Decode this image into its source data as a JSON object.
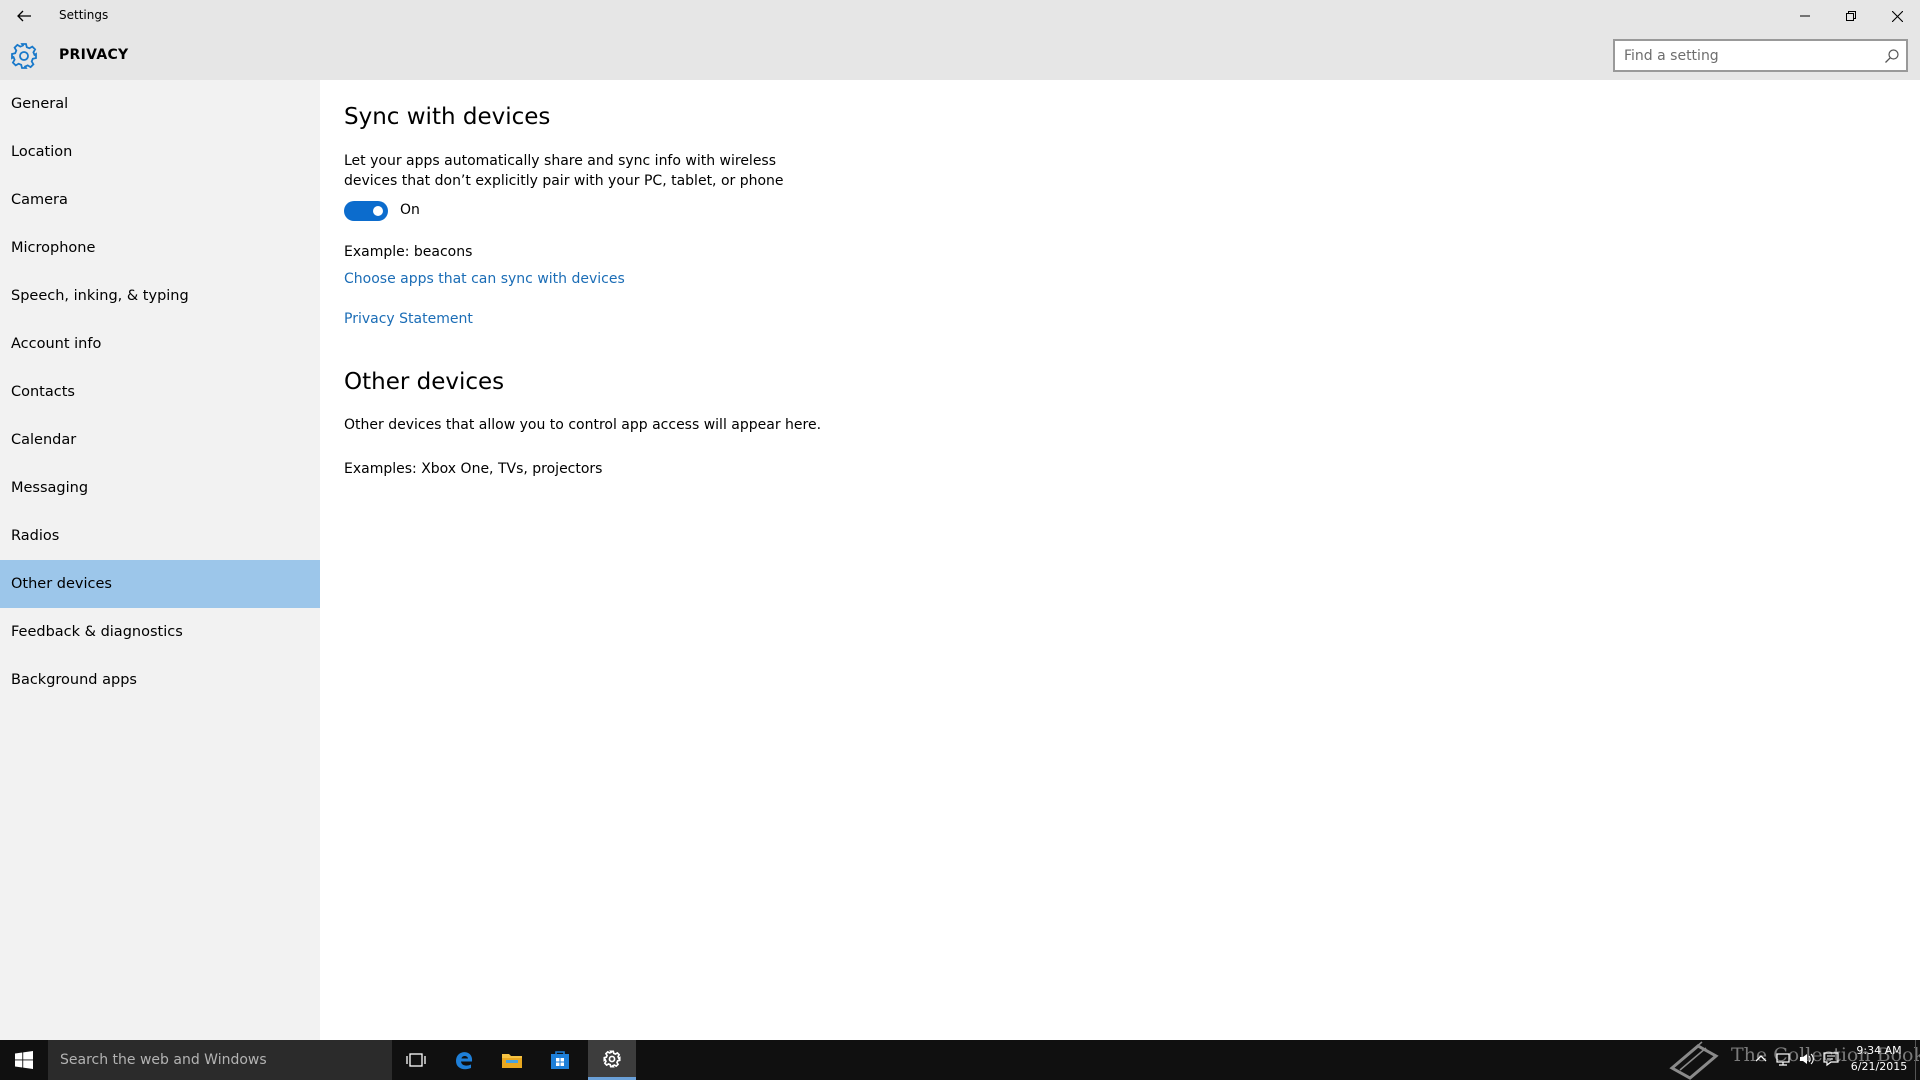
{
  "window": {
    "title": "Settings"
  },
  "header": {
    "section_title": "PRIVACY",
    "search_placeholder": "Find a setting"
  },
  "sidebar": {
    "items": [
      {
        "label": "General"
      },
      {
        "label": "Location"
      },
      {
        "label": "Camera"
      },
      {
        "label": "Microphone"
      },
      {
        "label": "Speech, inking, & typing"
      },
      {
        "label": "Account info"
      },
      {
        "label": "Contacts"
      },
      {
        "label": "Calendar"
      },
      {
        "label": "Messaging"
      },
      {
        "label": "Radios"
      },
      {
        "label": "Other devices",
        "selected": true
      },
      {
        "label": "Feedback & diagnostics"
      },
      {
        "label": "Background apps"
      }
    ]
  },
  "main": {
    "sync_heading": "Sync with devices",
    "sync_desc_line1": "Let your apps automatically share and sync info with wireless",
    "sync_desc_line2": "devices that don’t explicitly pair with your PC, tablet, or phone",
    "toggle_state": "On",
    "example_text": "Example: beacons",
    "choose_apps_link": "Choose apps that can sync with devices",
    "privacy_link": "Privacy Statement",
    "other_heading": "Other devices",
    "other_desc": "Other devices that allow you to control app access will appear here.",
    "other_examples": "Examples: Xbox One, TVs, projectors"
  },
  "taskbar": {
    "search_text": "Search the web and Windows",
    "watermark": "The Collection Book",
    "time": "9:34 AM",
    "date": "6/21/2015"
  },
  "colors": {
    "accent": "#0c6ccd",
    "link": "#1b6db6",
    "selected_nav": "#9cc6ea",
    "titlebar": "#e6e6e6",
    "sidebar": "#f2f2f2",
    "taskbar": "#101010"
  },
  "icons": [
    "back-arrow-icon",
    "minimize-icon",
    "maximize-icon",
    "close-icon",
    "gear-icon",
    "search-icon",
    "windows-logo-icon",
    "task-view-icon",
    "edge-icon",
    "file-explorer-icon",
    "store-icon",
    "settings-icon",
    "book-icon",
    "chevron-up-icon",
    "network-icon",
    "volume-icon",
    "notifications-icon"
  ]
}
